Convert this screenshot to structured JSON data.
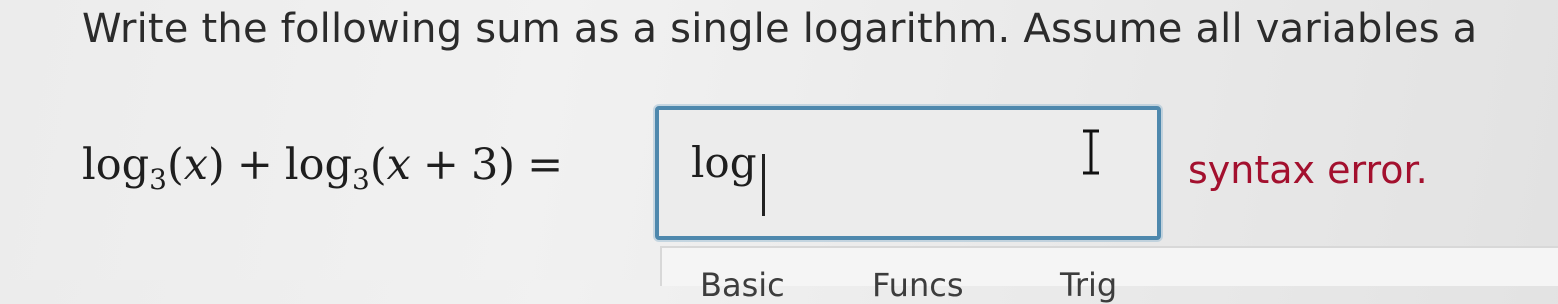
{
  "question": {
    "text": "Write the following sum as a single logarithm. Assume all variables a"
  },
  "equation": {
    "log1": "log",
    "base1": "3",
    "arg1_open": "(",
    "arg1_var": "x",
    "arg1_close": ")",
    "plus": "+",
    "log2": "log",
    "base2": "3",
    "arg2_open": "(",
    "arg2_var": "x",
    "arg2_plus": "+",
    "arg2_num": "3",
    "arg2_close": ")",
    "equals": "="
  },
  "answer": {
    "value": "log"
  },
  "feedback": {
    "error_text": "syntax error."
  },
  "palette": {
    "tabs": [
      "Basic",
      "Funcs",
      "Trig"
    ]
  },
  "colors": {
    "error": "#a3102e",
    "box_border": "#4e88ad"
  },
  "icons": {
    "cursor": "text-cursor-icon"
  }
}
